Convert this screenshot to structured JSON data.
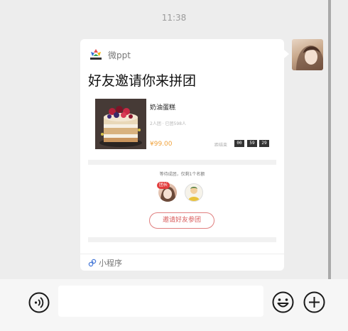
{
  "status": {
    "time": "11:38"
  },
  "card": {
    "source_name": "微ppt",
    "title": "好友邀请你来拼团",
    "product": {
      "name": "奶油蛋糕",
      "meta": "2人团 · 已团598人",
      "price": "¥99.00",
      "countdown_label": "距结束",
      "countdown": [
        "00",
        "59",
        "29"
      ]
    },
    "hint": "等待成团，仅剩1个名额",
    "leader_badge": "团长",
    "invite_label": "邀请好友参团",
    "mini_program_label": "小程序"
  },
  "icons": {
    "voice": "voice-icon",
    "emoji": "emoji-icon",
    "plus": "plus-icon"
  },
  "colors": {
    "price": "#f0a23b",
    "invite_button": "#d85a5a",
    "leader_badge": "#e23c3c"
  }
}
